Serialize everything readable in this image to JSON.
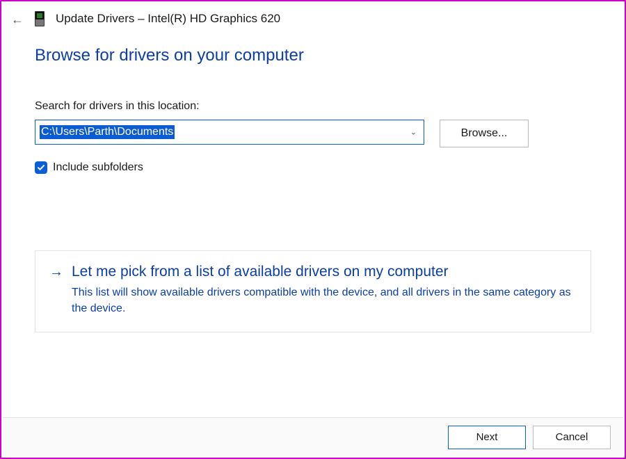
{
  "window": {
    "title": "Update Drivers – Intel(R) HD Graphics 620"
  },
  "heading": "Browse for drivers on your computer",
  "location": {
    "label": "Search for drivers in this location:",
    "value": "C:\\Users\\Parth\\Documents",
    "browse_label": "Browse..."
  },
  "include_subfolders": {
    "checked": true,
    "label": "Include subfolders"
  },
  "pick_option": {
    "title": "Let me pick from a list of available drivers on my computer",
    "description": "This list will show available drivers compatible with the device, and all drivers in the same category as the device."
  },
  "footer": {
    "next": "Next",
    "cancel": "Cancel"
  }
}
